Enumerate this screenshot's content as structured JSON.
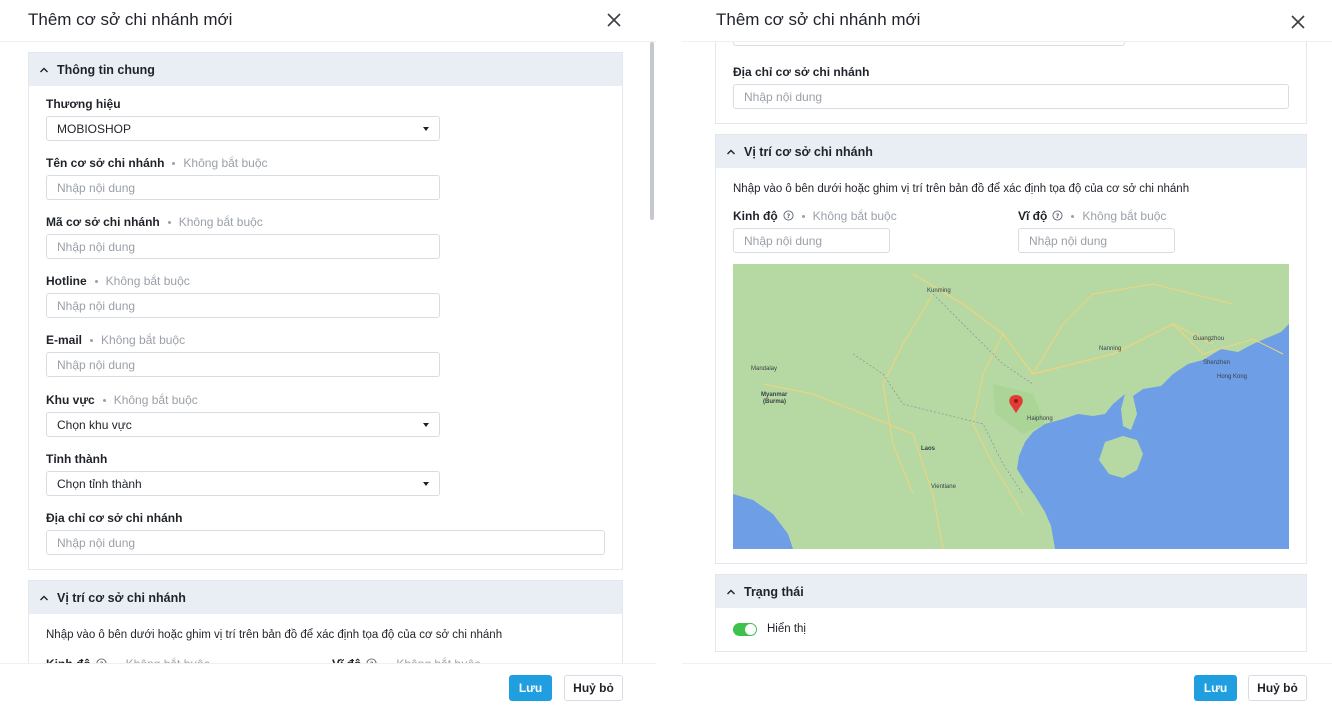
{
  "dialog": {
    "title": "Thêm cơ sở chi nhánh mới",
    "save_label": "Lưu",
    "cancel_label": "Huỷ bỏ"
  },
  "optional_text": "Không bắt buộc",
  "placeholder": "Nhập nội dung",
  "general": {
    "title": "Thông tin chung",
    "brand_label": "Thương hiệu",
    "brand_value": "MOBIOSHOP",
    "name_label": "Tên cơ sở chi nhánh",
    "code_label": "Mã cơ sở chi nhánh",
    "hotline_label": "Hotline",
    "email_label": "E-mail",
    "region_label": "Khu vực",
    "region_value": "Chọn khu vực",
    "province_label": "Tỉnh thành",
    "province_value": "Chọn tỉnh thành",
    "address_label": "Địa chỉ cơ sở chi nhánh"
  },
  "location": {
    "title": "Vị trí cơ sở chi nhánh",
    "description": "Nhập vào ô bên dưới hoặc ghim vị trí trên bản đồ để xác định tọa độ của cơ sở chi nhánh",
    "longitude_label": "Kinh độ",
    "latitude_label": "Vĩ độ"
  },
  "map": {
    "labels": [
      "Kunming",
      "Nanning",
      "Guangzhou",
      "Shenzhen",
      "Hong Kong",
      "Mandalay",
      "Myanmar",
      "(Burma)",
      "Laos",
      "Haiphong",
      "Vientiane"
    ],
    "colors": {
      "land": "#b6d9a4",
      "water": "#6e9fe6",
      "pin": "#e53935"
    }
  },
  "status": {
    "title": "Trạng thái",
    "visible_label": "Hiển thị",
    "visible": true
  },
  "colors": {
    "primary": "#1f9ee0",
    "section_header": "#e9eef5",
    "toggle_on": "#3fc24b"
  }
}
